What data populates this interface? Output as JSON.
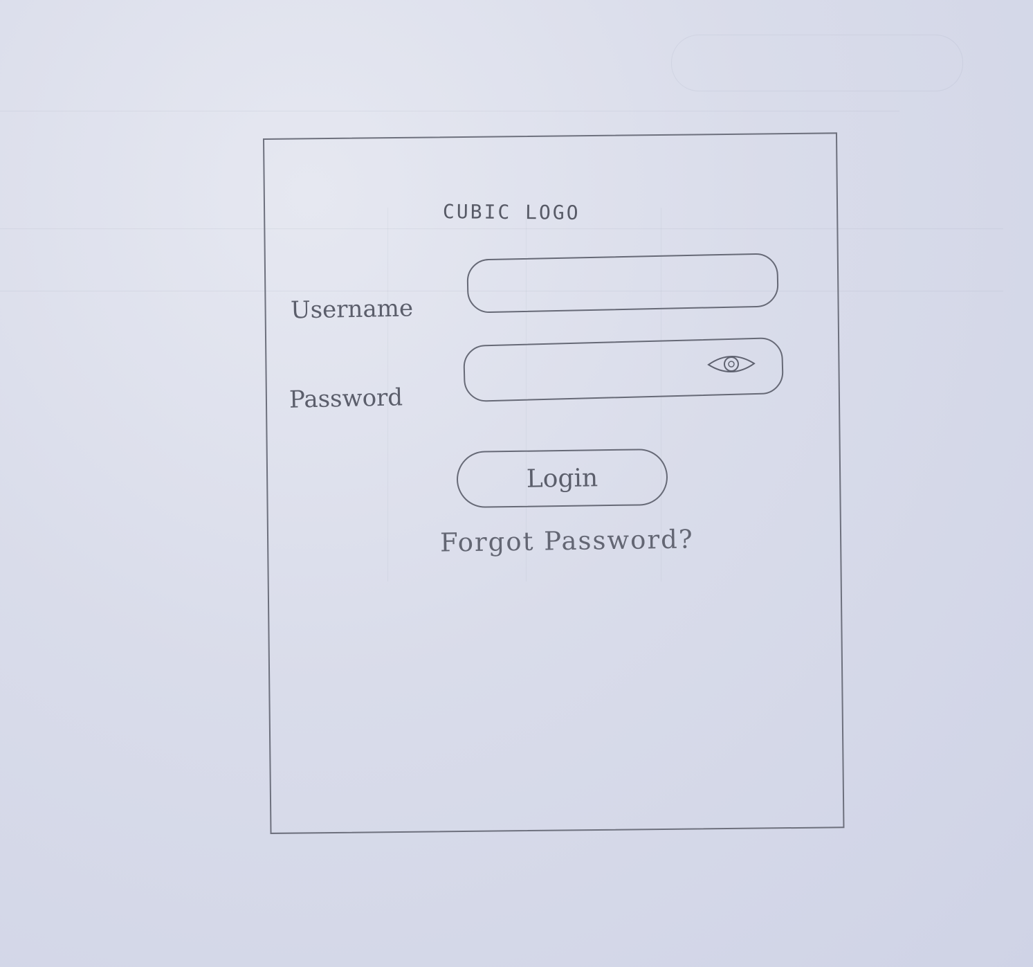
{
  "login_screen": {
    "logo_text": "CUBIC LOGO",
    "username_label": "Username",
    "username_value": "",
    "password_label": "Password",
    "password_value": "",
    "password_toggle_icon": "eye-icon",
    "login_button_label": "Login",
    "forgot_password_link": "Forgot Password?"
  },
  "colors": {
    "paper": "#d9dcea",
    "pencil": "#666976"
  }
}
